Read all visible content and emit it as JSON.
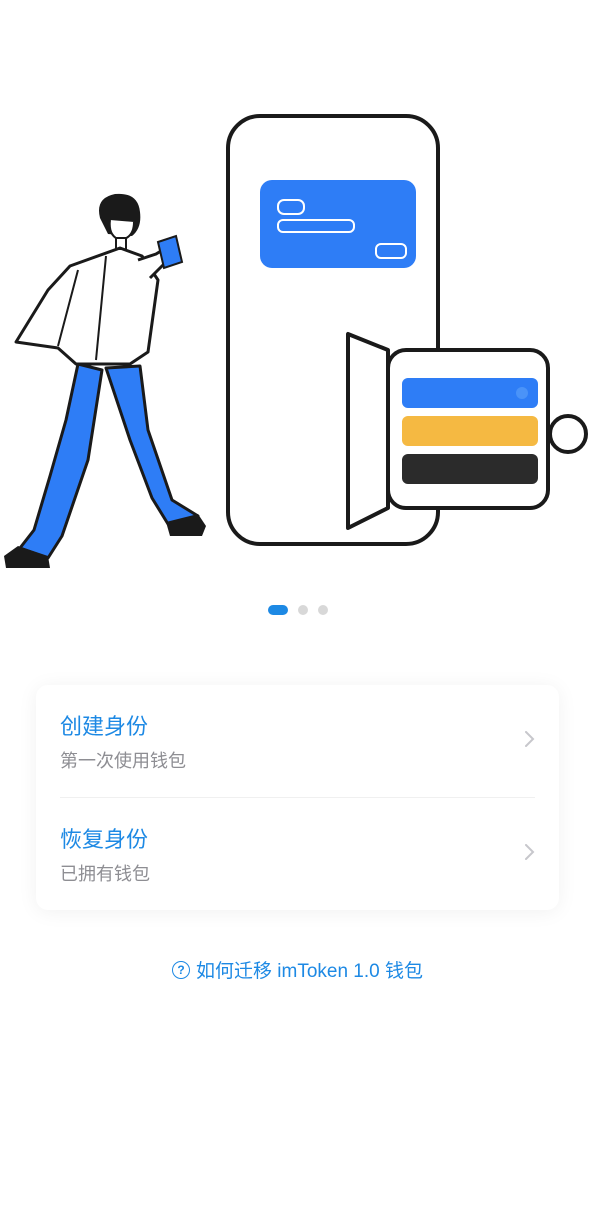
{
  "pagination": {
    "total": 3,
    "active": 0
  },
  "options": [
    {
      "title": "创建身份",
      "subtitle": "第一次使用钱包"
    },
    {
      "title": "恢复身份",
      "subtitle": "已拥有钱包"
    }
  ],
  "help": {
    "icon": "?",
    "text": "如何迁移 imToken 1.0 钱包"
  },
  "colors": {
    "accent": "#1d89e4",
    "card_blue": "#2e7df6",
    "card_yellow": "#f5b942",
    "card_black": "#2b2b2b"
  }
}
